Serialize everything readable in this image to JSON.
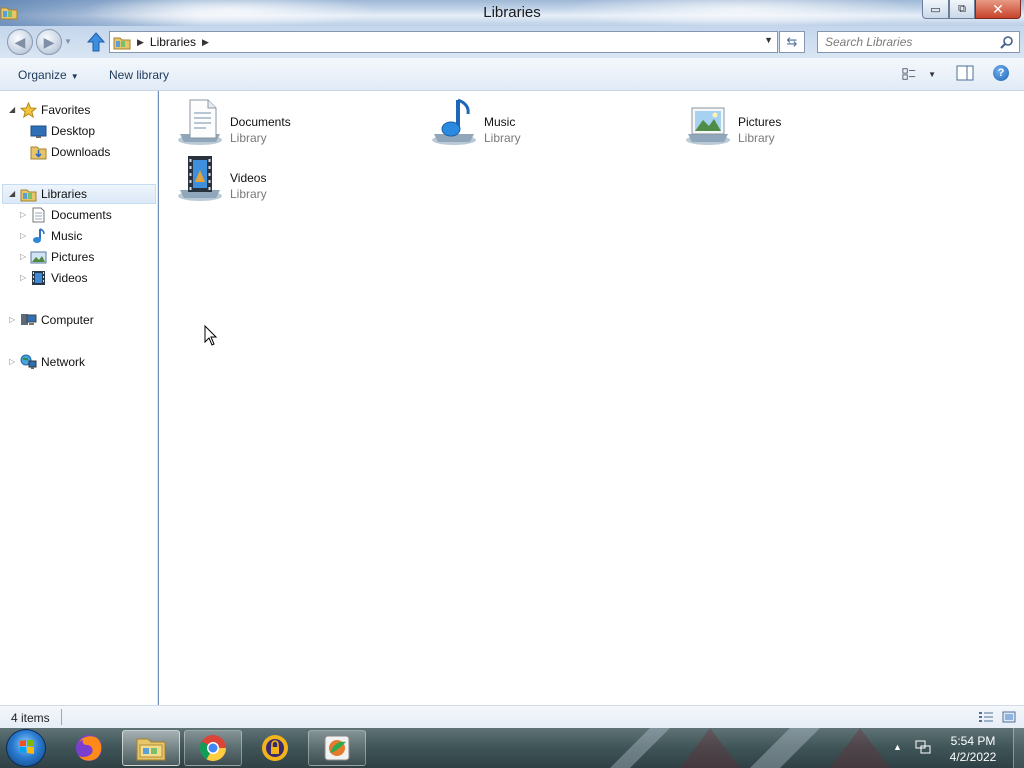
{
  "window": {
    "title": "Libraries",
    "min_glyph": "▭",
    "max_glyph": "⧉",
    "close_glyph": "✕"
  },
  "address": {
    "crumbs": [
      "Libraries"
    ],
    "search_placeholder": "Search Libraries"
  },
  "commands": {
    "organize": "Organize",
    "new_library": "New library"
  },
  "nav_pane": {
    "favorites": {
      "label": "Favorites",
      "items": [
        "Desktop",
        "Downloads"
      ]
    },
    "libraries": {
      "label": "Libraries",
      "items": [
        "Documents",
        "Music",
        "Pictures",
        "Videos"
      ]
    },
    "computer": "Computer",
    "network": "Network"
  },
  "libraries": [
    {
      "name": "Documents",
      "type": "Library",
      "icon": "documents-library-icon"
    },
    {
      "name": "Music",
      "type": "Library",
      "icon": "music-library-icon"
    },
    {
      "name": "Pictures",
      "type": "Library",
      "icon": "pictures-library-icon"
    },
    {
      "name": "Videos",
      "type": "Library",
      "icon": "videos-library-icon"
    }
  ],
  "status": {
    "count": "4 items"
  },
  "taskbar": {
    "apps": [
      "firefox-icon",
      "explorer-icon",
      "chrome-icon",
      "vpn-icon",
      "paint-app-icon"
    ],
    "time": "5:54 PM",
    "date": "4/2/2022"
  },
  "colors": {
    "accent": "#1e395b",
    "selection": "#dce9f7",
    "taskbar": "#3f5457"
  }
}
